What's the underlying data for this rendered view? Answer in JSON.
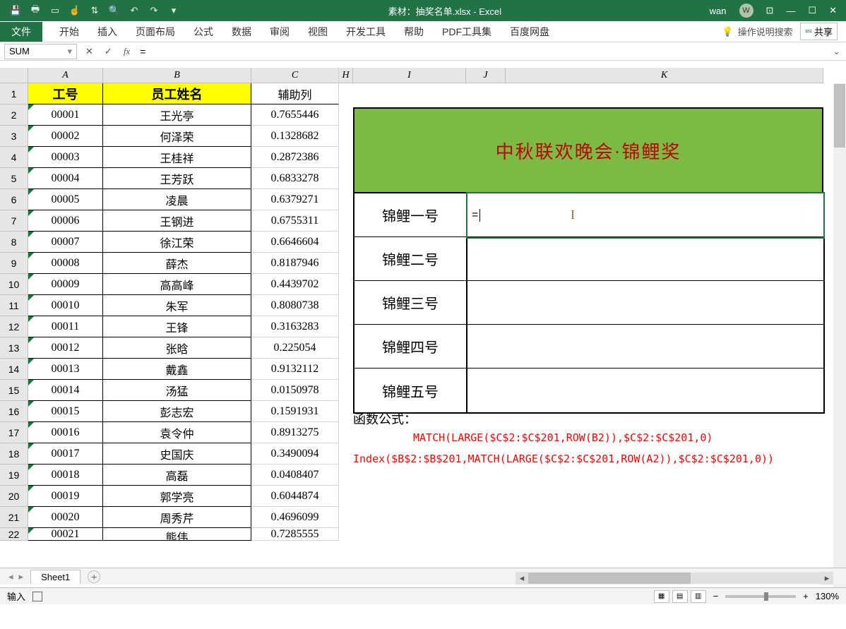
{
  "titlebar": {
    "filename": "素材：抽奖名单.xlsx - Excel",
    "user": "wan",
    "user_initial": "W"
  },
  "ribbon": {
    "tabs": [
      "文件",
      "开始",
      "插入",
      "页面布局",
      "公式",
      "数据",
      "审阅",
      "视图",
      "开发工具",
      "帮助",
      "PDF工具集",
      "百度网盘"
    ],
    "tell_me": "操作说明搜索",
    "share": "共享"
  },
  "namebox": "SUM",
  "formula_bar": "=",
  "columns": [
    "A",
    "B",
    "C",
    "H",
    "I",
    "J",
    "K"
  ],
  "rows": [
    "1",
    "2",
    "3",
    "4",
    "5",
    "6",
    "7",
    "8",
    "9",
    "10",
    "11",
    "12",
    "13",
    "14",
    "15",
    "16",
    "17",
    "18",
    "19",
    "20",
    "21",
    "22"
  ],
  "headers": {
    "A": "工号",
    "B": "员工姓名",
    "C": "辅助列"
  },
  "data": [
    {
      "id": "00001",
      "name": "王光亭",
      "rnd": "0.7655446"
    },
    {
      "id": "00002",
      "name": "何泽荣",
      "rnd": "0.1328682"
    },
    {
      "id": "00003",
      "name": "王桂祥",
      "rnd": "0.2872386"
    },
    {
      "id": "00004",
      "name": "王芳跃",
      "rnd": "0.6833278"
    },
    {
      "id": "00005",
      "name": "凌晨",
      "rnd": "0.6379271"
    },
    {
      "id": "00006",
      "name": "王钢进",
      "rnd": "0.6755311"
    },
    {
      "id": "00007",
      "name": "徐江荣",
      "rnd": "0.6646604"
    },
    {
      "id": "00008",
      "name": "薛杰",
      "rnd": "0.8187946"
    },
    {
      "id": "00009",
      "name": "高高峰",
      "rnd": "0.4439702"
    },
    {
      "id": "00010",
      "name": "朱军",
      "rnd": "0.8080738"
    },
    {
      "id": "00011",
      "name": "王锋",
      "rnd": "0.3163283"
    },
    {
      "id": "00012",
      "name": "张晗",
      "rnd": "0.225054"
    },
    {
      "id": "00013",
      "name": "戴鑫",
      "rnd": "0.9132112"
    },
    {
      "id": "00014",
      "name": "汤猛",
      "rnd": "0.0150978"
    },
    {
      "id": "00015",
      "name": "彭志宏",
      "rnd": "0.1591931"
    },
    {
      "id": "00016",
      "name": "袁令仲",
      "rnd": "0.8913275"
    },
    {
      "id": "00017",
      "name": "史国庆",
      "rnd": "0.3490094"
    },
    {
      "id": "00018",
      "name": "高磊",
      "rnd": "0.0408407"
    },
    {
      "id": "00019",
      "name": "郭学亮",
      "rnd": "0.6044874"
    },
    {
      "id": "00020",
      "name": "周秀芹",
      "rnd": "0.4696099"
    },
    {
      "id": "00021",
      "name": "熊伟",
      "rnd": "0.7285555"
    }
  ],
  "banner": "中秋联欢晚会·锦鲤奖",
  "prizes": [
    "锦鲤一号",
    "锦鲤二号",
    "锦鲤三号",
    "锦鲤四号",
    "锦鲤五号"
  ],
  "prize_editing_value": "=",
  "formula_label": "函数公式：",
  "formula1": "MATCH(LARGE($C$2:$C$201,ROW(B2)),$C$2:$C$201,0)",
  "formula2": "Index($B$2:$B$201,MATCH(LARGE($C$2:$C$201,ROW(A2)),$C$2:$C$201,0))",
  "sheet_tab": "Sheet1",
  "status": {
    "mode": "输入",
    "zoom": "130%"
  }
}
